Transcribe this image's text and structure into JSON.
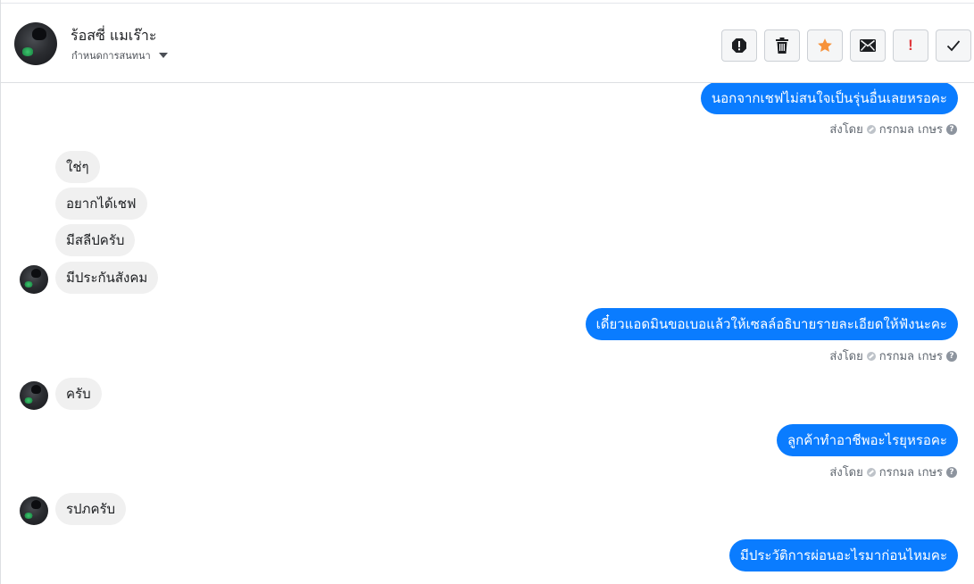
{
  "header": {
    "contact_name": "ร้อสซี่ แมเร๊าะ",
    "assign_label": "กำหนดการสนทนา",
    "actions": [
      {
        "name": "spam-icon",
        "label": "spam"
      },
      {
        "name": "trash-icon",
        "label": "delete"
      },
      {
        "name": "star-icon",
        "label": "star"
      },
      {
        "name": "mail-icon",
        "label": "mark unread"
      },
      {
        "name": "follow-up-icon",
        "label": "follow up"
      },
      {
        "name": "check-icon",
        "label": "done"
      }
    ],
    "colors": {
      "star": "#f7923a",
      "follow_up": "#e0393e",
      "icon": "#1c1e21"
    }
  },
  "thread": {
    "messages": [
      {
        "direction": "outgoing",
        "text": "นอกจากเชฟไม่สนใจเป็นรุ่นอื่นเลยหรอคะ",
        "sent_by_label": "ส่งโดย",
        "sender": "กรกมล เกษร"
      },
      {
        "direction": "incoming",
        "text": "ใช่ๆ"
      },
      {
        "direction": "incoming",
        "text": "อยากได้เชฟ"
      },
      {
        "direction": "incoming",
        "text": "มีสลีปครับ"
      },
      {
        "direction": "incoming",
        "text": "มีประกันสังคม"
      },
      {
        "direction": "outgoing",
        "text": "เดี๋ยวแอดมินขอเบอแล้วให้เซลล์อธิบายรายละเอียดให้ฟังนะคะ",
        "sent_by_label": "ส่งโดย",
        "sender": "กรกมล เกษร"
      },
      {
        "direction": "incoming",
        "text": "ครับ"
      },
      {
        "direction": "outgoing",
        "text": "ลูกค้าทำอาชีพอะไรยุหรอคะ",
        "sent_by_label": "ส่งโดย",
        "sender": "กรกมล เกษร"
      },
      {
        "direction": "incoming",
        "text": "รปภครับ"
      },
      {
        "direction": "outgoing",
        "text": "มีประวัติการผ่อนอะไรมาก่อนไหมคะ"
      }
    ],
    "colors": {
      "outgoing_bubble": "#0a7cff",
      "incoming_bubble": "#f0f0f0"
    }
  }
}
